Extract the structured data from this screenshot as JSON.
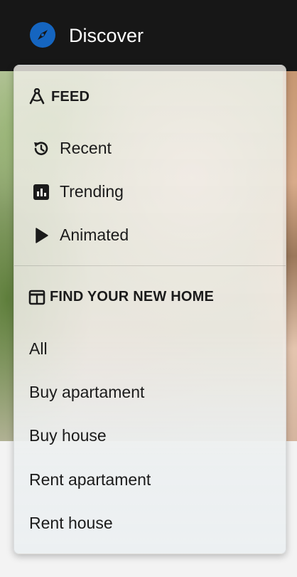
{
  "header": {
    "title": "Discover",
    "icon": "compass-icon",
    "accent_color": "#1565c0"
  },
  "menu": {
    "feed": {
      "heading": "FEED",
      "icon": "compass-drafting-icon",
      "items": [
        {
          "label": "Recent",
          "icon": "history-icon"
        },
        {
          "label": "Trending",
          "icon": "bar-chart-icon"
        },
        {
          "label": "Animated",
          "icon": "play-icon"
        }
      ]
    },
    "home": {
      "heading": "FIND YOUR NEW HOME",
      "icon": "columns-icon",
      "items": [
        {
          "label": "All"
        },
        {
          "label": "Buy apartament"
        },
        {
          "label": "Buy house"
        },
        {
          "label": "Rent apartament"
        },
        {
          "label": "Rent house"
        }
      ]
    }
  }
}
